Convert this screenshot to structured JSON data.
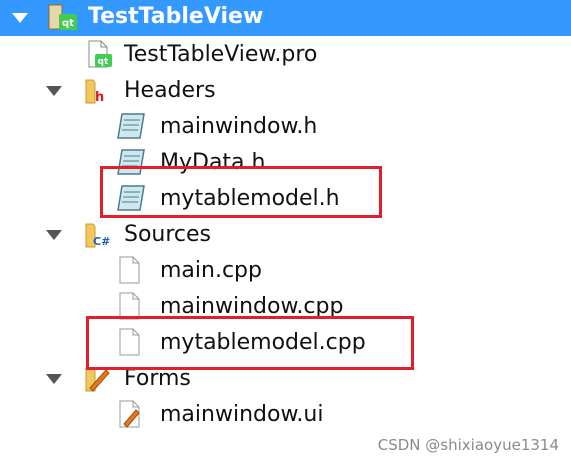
{
  "tree": {
    "root": {
      "label": "TestTableView"
    },
    "project_file": {
      "label": "TestTableView.pro"
    },
    "headers": {
      "label": "Headers",
      "items": [
        {
          "label": "mainwindow.h"
        },
        {
          "label": "MyData.h"
        },
        {
          "label": "mytablemodel.h"
        }
      ]
    },
    "sources": {
      "label": "Sources",
      "items": [
        {
          "label": "main.cpp"
        },
        {
          "label": "mainwindow.cpp"
        },
        {
          "label": "mytablemodel.cpp"
        }
      ]
    },
    "forms": {
      "label": "Forms",
      "items": [
        {
          "label": "mainwindow.ui"
        }
      ]
    }
  },
  "annotation_color": "#e01f2d",
  "selection_color": "#3399ff",
  "watermark": "CSDN @shixiaoyue1314"
}
